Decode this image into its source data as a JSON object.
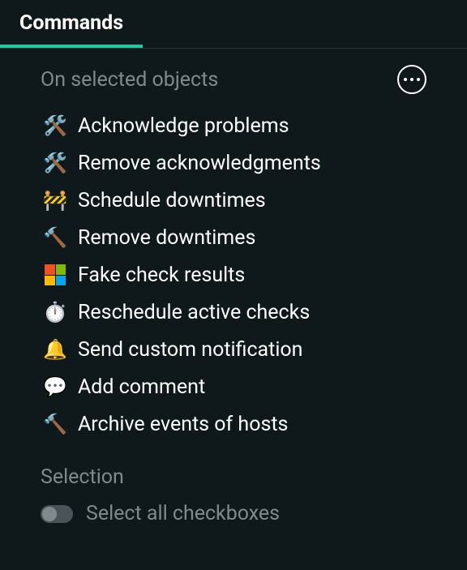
{
  "tab": {
    "label": "Commands"
  },
  "sections": {
    "on_selected": {
      "title": "On selected objects",
      "items": [
        {
          "icon": "🛠️",
          "label": "Acknowledge problems"
        },
        {
          "icon": "🛠️",
          "label": "Remove acknowledgments"
        },
        {
          "icon": "🚧",
          "label": "Schedule downtimes"
        },
        {
          "icon": "🔨",
          "label": "Remove downtimes"
        },
        {
          "icon": "windows",
          "label": "Fake check results"
        },
        {
          "icon": "⏱️",
          "label": "Reschedule active checks"
        },
        {
          "icon": "🔔",
          "label": "Send custom notification"
        },
        {
          "icon": "💬",
          "label": "Add comment"
        },
        {
          "icon": "🔨",
          "label": "Archive events of hosts"
        }
      ]
    },
    "selection": {
      "title": "Selection",
      "toggle_label": "Select all checkboxes"
    }
  }
}
